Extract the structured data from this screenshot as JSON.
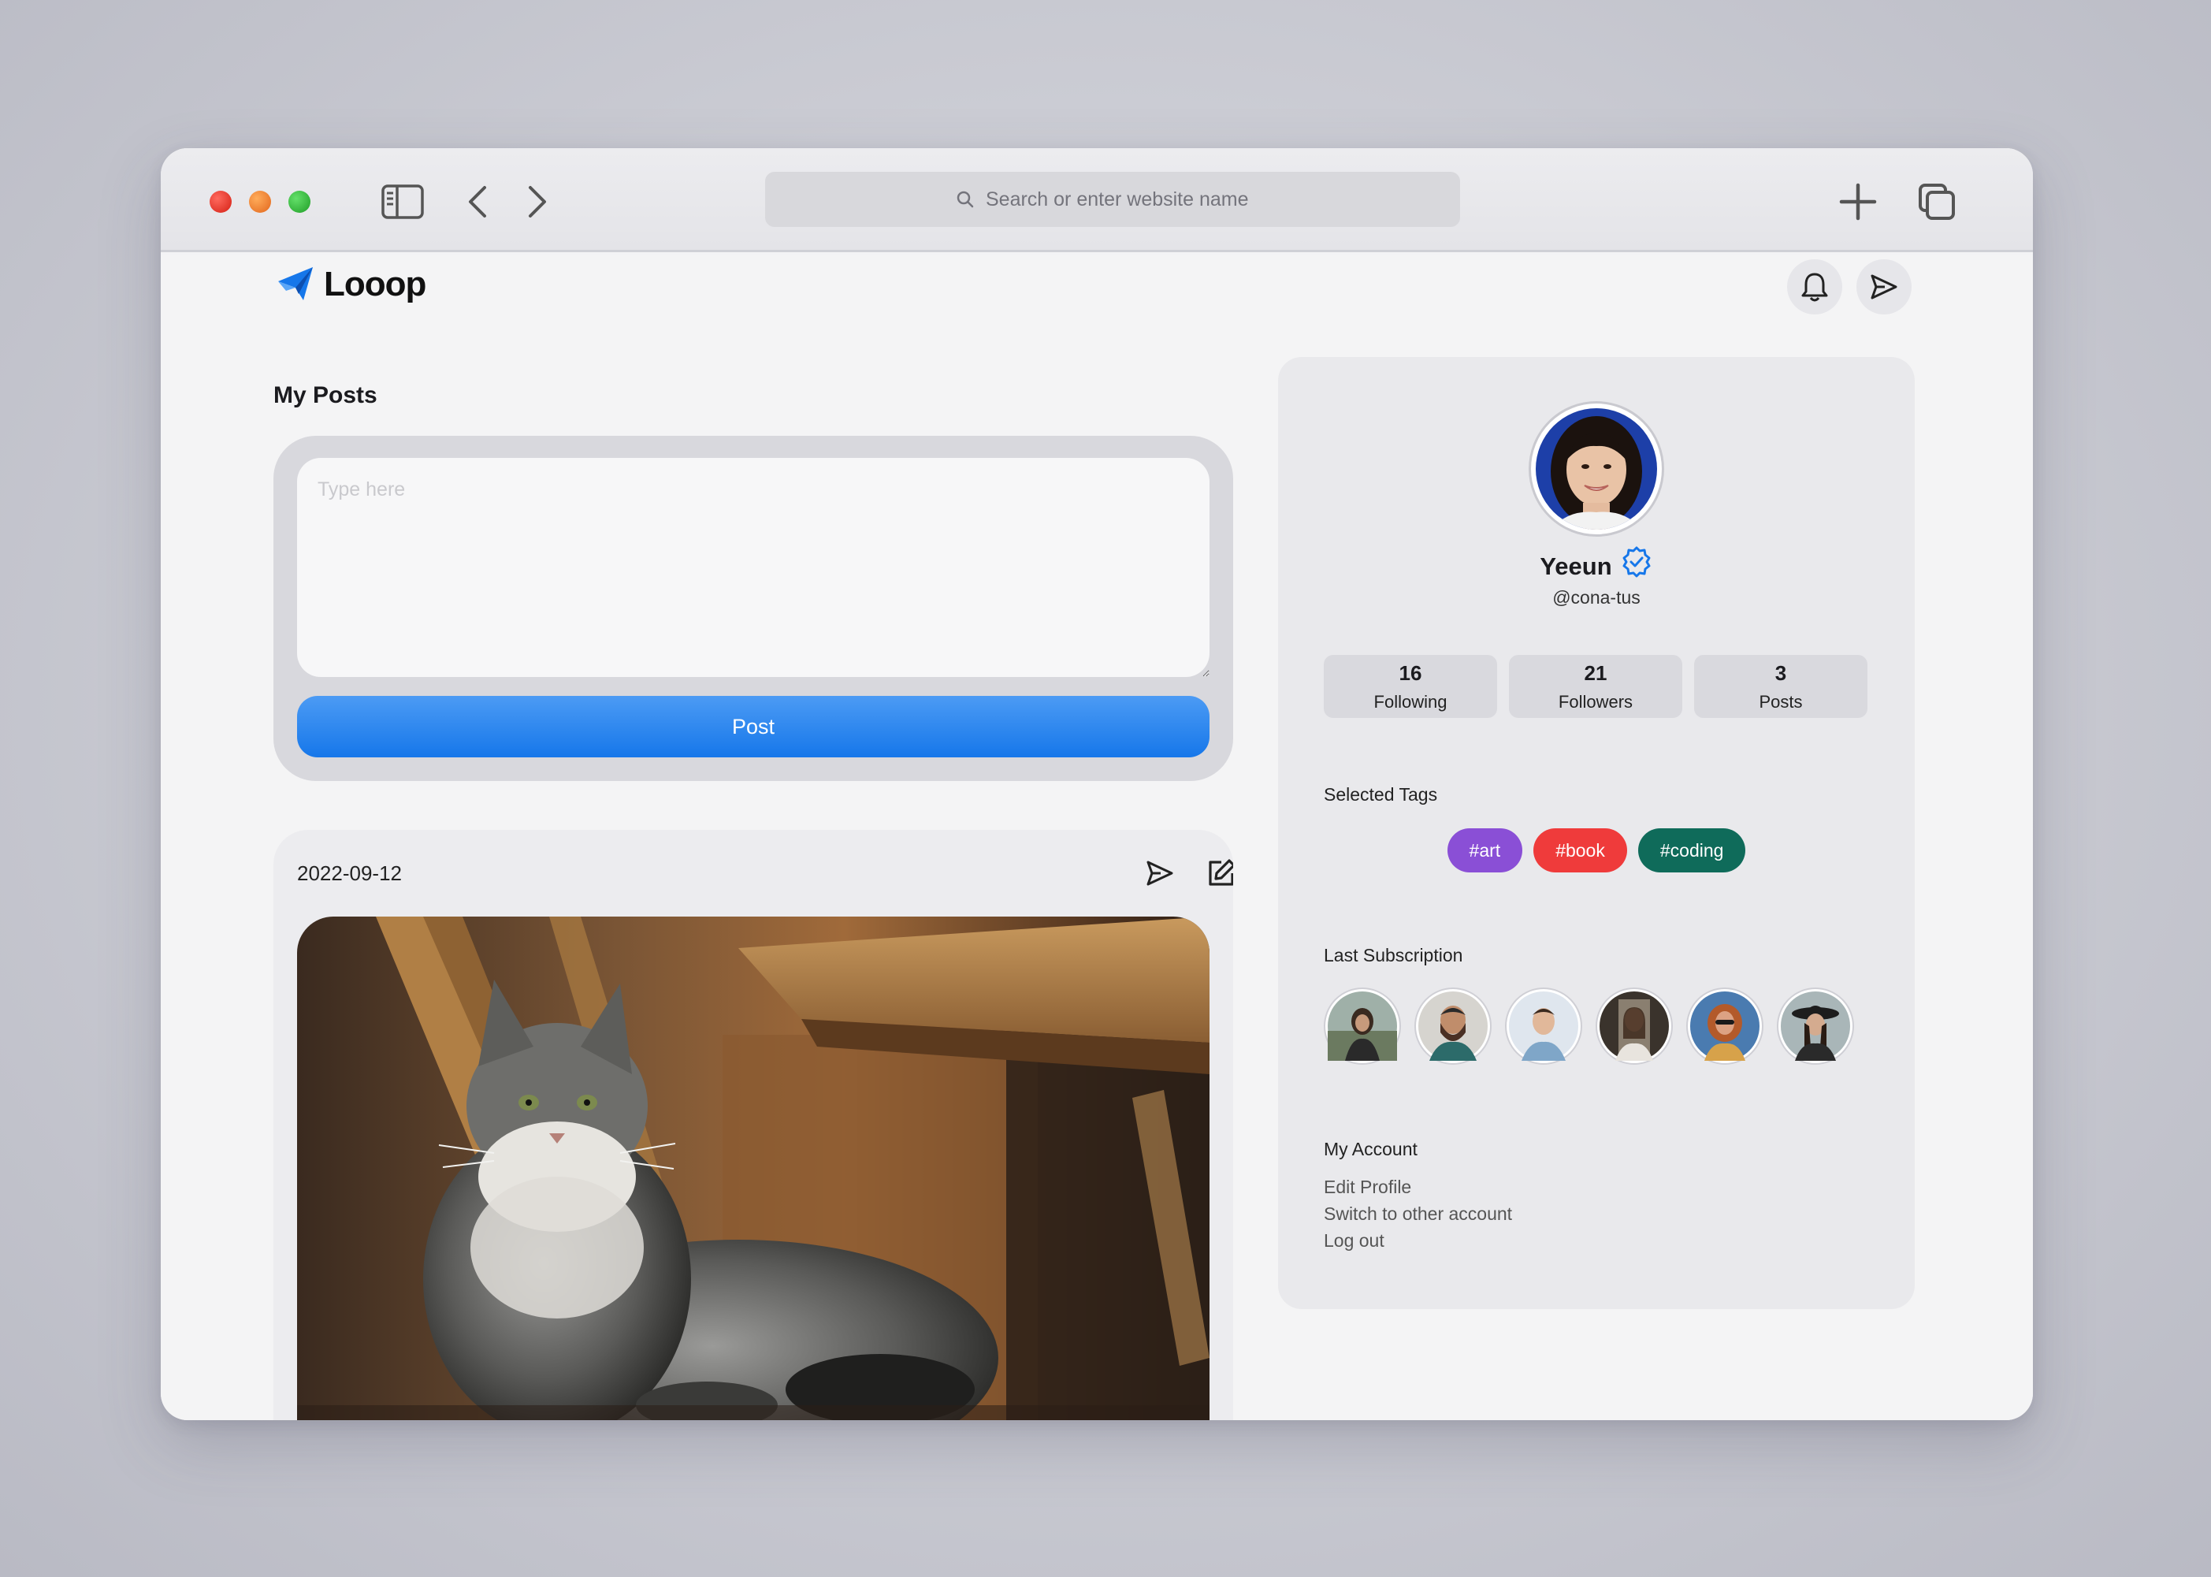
{
  "browser": {
    "search_placeholder": "Search or enter website name"
  },
  "app": {
    "name": "Looop",
    "accent_color": "#1677ea"
  },
  "posts_section": {
    "title": "My Posts",
    "compose_placeholder": "Type here",
    "post_button": "Post"
  },
  "post": {
    "date": "2022-09-12"
  },
  "profile": {
    "name": "Yeeun",
    "handle": "@cona-tus",
    "verified": true,
    "stats": [
      {
        "value": "16",
        "label": "Following"
      },
      {
        "value": "21",
        "label": "Followers"
      },
      {
        "value": "3",
        "label": "Posts"
      }
    ],
    "tags_label": "Selected Tags",
    "tags": [
      {
        "label": "#art",
        "color": "#8a4fd6"
      },
      {
        "label": "#book",
        "color": "#ef3b3b"
      },
      {
        "label": "#coding",
        "color": "#0f6b5a"
      }
    ],
    "subscriptions_label": "Last Subscription",
    "account": {
      "title": "My Account",
      "links": [
        "Edit Profile",
        "Switch to other account",
        "Log out"
      ]
    }
  }
}
